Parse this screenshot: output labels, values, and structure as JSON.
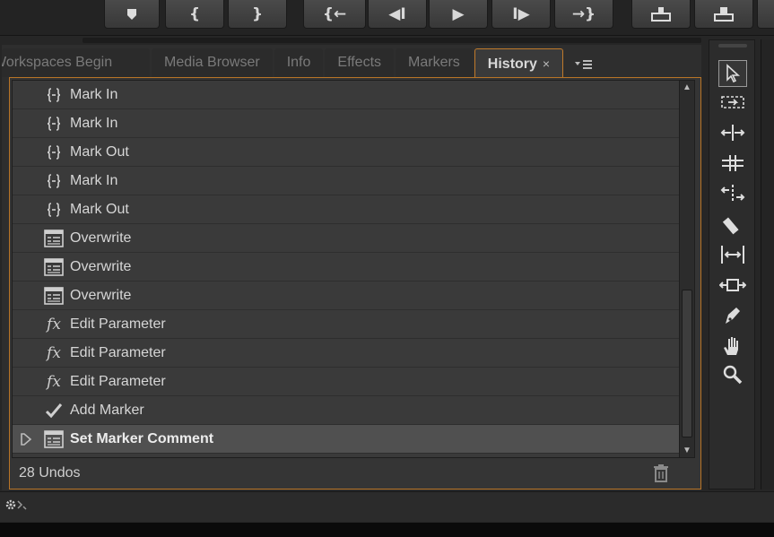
{
  "tabs": [
    {
      "label": "Workspaces Begin"
    },
    {
      "label": "Media Browser"
    },
    {
      "label": "Info"
    },
    {
      "label": "Effects"
    },
    {
      "label": "Markers"
    },
    {
      "label": "History",
      "active": true,
      "close": "×"
    }
  ],
  "history": {
    "items": [
      {
        "icon": "mark-in-icon",
        "label": "Mark In"
      },
      {
        "icon": "mark-in-icon",
        "label": "Mark In"
      },
      {
        "icon": "mark-out-icon",
        "label": "Mark Out"
      },
      {
        "icon": "mark-in-icon",
        "label": "Mark In"
      },
      {
        "icon": "mark-out-icon",
        "label": "Mark Out"
      },
      {
        "icon": "overwrite-icon",
        "label": "Overwrite"
      },
      {
        "icon": "overwrite-icon",
        "label": "Overwrite"
      },
      {
        "icon": "overwrite-icon",
        "label": "Overwrite"
      },
      {
        "icon": "fx-icon",
        "label": "Edit Parameter"
      },
      {
        "icon": "fx-icon",
        "label": "Edit Parameter"
      },
      {
        "icon": "fx-icon",
        "label": "Edit Parameter"
      },
      {
        "icon": "checkmark-icon",
        "label": "Add Marker"
      },
      {
        "icon": "overwrite-icon",
        "label": "Set Marker Comment",
        "selected": true
      }
    ],
    "undos_label": "28 Undos"
  },
  "colors": {
    "active_border": "#b87426",
    "panel_bg": "#3a3a3a",
    "selected_row": "#505050"
  }
}
